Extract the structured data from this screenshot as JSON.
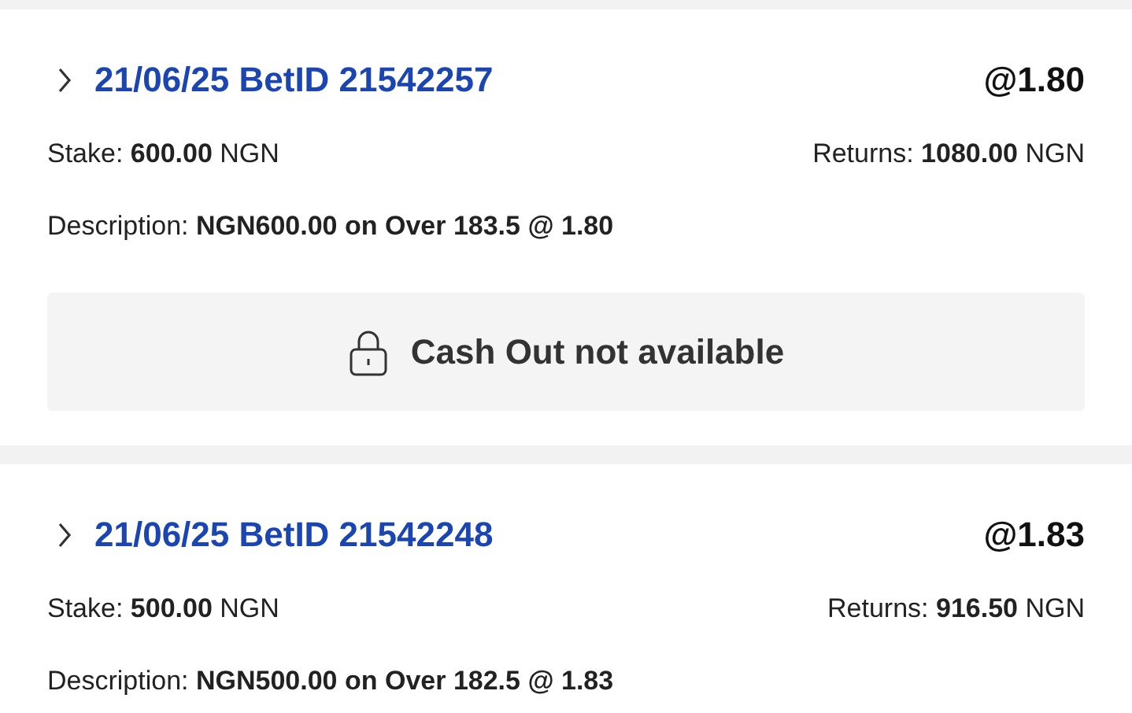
{
  "bets": [
    {
      "title": "21/06/25 BetID 21542257",
      "odds": "@1.80",
      "stake": "Stake: **600.00** NGN",
      "returns": "Returns: **1080.00** NGN",
      "description": "Description: **NGN600.00 on Over 183.5 @ 1.80**",
      "cash_out": {
        "label": "Cash Out not available"
      }
    },
    {
      "title": "21/06/25 BetID 21542248",
      "odds": "@1.83",
      "stake": "Stake: **500.00** NGN",
      "returns": "Returns: **916.50** NGN",
      "description": "Description: **NGN500.00 on Over 182.5 @ 1.83**"
    }
  ]
}
